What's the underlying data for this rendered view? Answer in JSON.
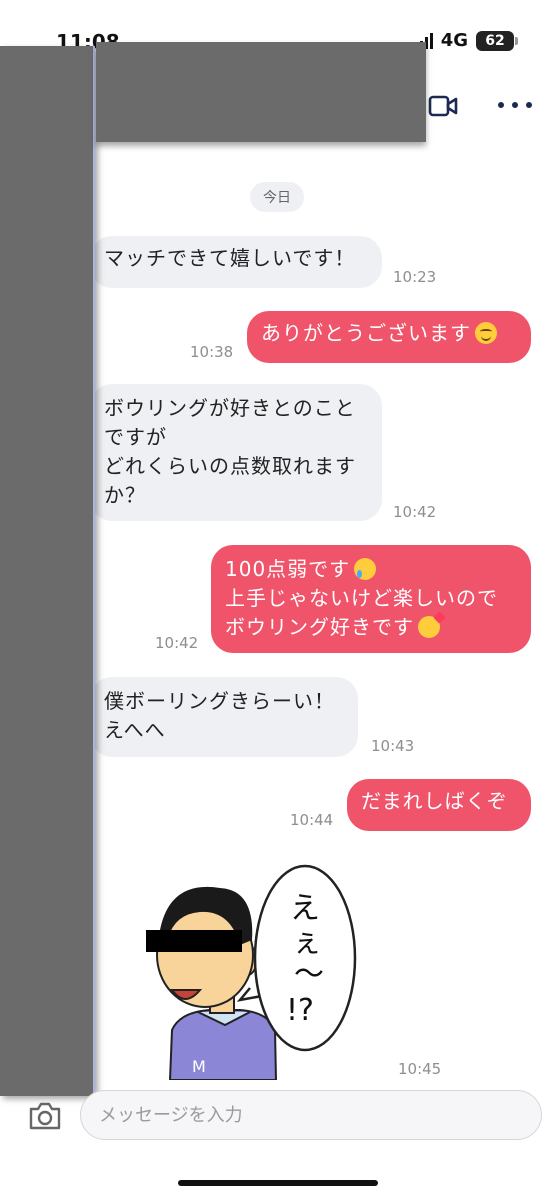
{
  "status_bar": {
    "time": "11:08",
    "network": "4G",
    "battery": "62"
  },
  "chat": {
    "date_label": "今日",
    "messages": [
      {
        "dir": "in",
        "lines": [
          "マッチできて嬉しいです！"
        ],
        "time": "10:23"
      },
      {
        "dir": "out",
        "lines": [
          "ありがとうございます"
        ],
        "emoji": "smiling-face",
        "time": "10:38"
      },
      {
        "dir": "in",
        "lines": [
          "ボウリングが好きとのこと",
          "ですが",
          "どれくらいの点数取れます",
          "か？"
        ],
        "time": "10:42"
      },
      {
        "dir": "out",
        "lines": [
          "100点弱です",
          "上手じゃないけど楽しいので",
          "ボウリング好きです"
        ],
        "emojis": [
          "crying-face",
          "smiling-face-with-hearts"
        ],
        "time": "10:42"
      },
      {
        "dir": "in",
        "lines": [
          "僕ボーリングきらーい！",
          "えへへ"
        ],
        "time": "10:43"
      },
      {
        "dir": "out",
        "lines": [
          "だまれしばくぞ"
        ],
        "time": "10:44"
      },
      {
        "dir": "in",
        "type": "sticker",
        "sticker_text": "ええ〜!?",
        "sticker_shirt_letter": "M",
        "time": "10:45"
      }
    ]
  },
  "input": {
    "placeholder": "メッセージを入力"
  },
  "icons": {
    "video": "video-camera-icon",
    "more": "more-dots-icon",
    "camera": "camera-icon"
  },
  "colors": {
    "outgoing_bubble": "#f0546a",
    "incoming_bubble": "#eef0f3",
    "icon_navy": "#1c2a52"
  }
}
